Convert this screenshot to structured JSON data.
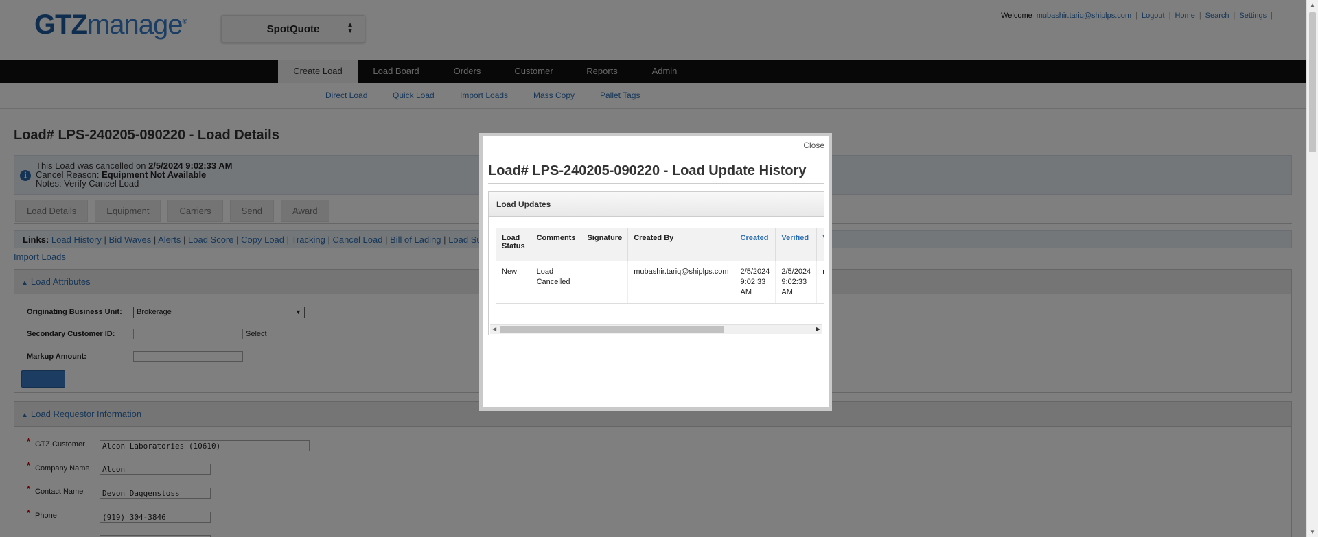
{
  "header": {
    "logo_main": "GTZ",
    "logo_sub": "manage",
    "logo_mark": "®",
    "app_select_value": "SpotQuote",
    "welcome_label": "Welcome",
    "user_email": "mubashir.tariq@shiplps.com",
    "links": [
      "Logout",
      "Home",
      "Search",
      "Settings"
    ]
  },
  "nav": {
    "tabs": [
      "Create Load",
      "Load Board",
      "Orders",
      "Customer",
      "Reports",
      "Admin"
    ],
    "active": "Create Load",
    "subnav": [
      "Direct Load",
      "Quick Load",
      "Import Loads",
      "Mass Copy",
      "Pallet Tags"
    ]
  },
  "page": {
    "title": "Load# LPS-240205-090220 - Load Details",
    "notice": {
      "line1_prefix": "This Load was cancelled on",
      "line1_value": "2/5/2024 9:02:33 AM",
      "line2_prefix": "Cancel Reason:",
      "line2_value": "Equipment Not Available",
      "line3": "Notes: Verify Cancel Load"
    },
    "subtabs": [
      "Load Details",
      "Equipment",
      "Carriers",
      "Send",
      "Award"
    ],
    "links_label": "Links:",
    "links": [
      "Load History",
      "Bid Waves",
      "Alerts",
      "Load Score",
      "Copy Load",
      "Tracking",
      "Cancel Load",
      "Bill of Lading",
      "Load Su"
    ],
    "import_loads": "Import Loads"
  },
  "attributes": {
    "heading": "Load Attributes",
    "business_unit_label": "Originating Business Unit:",
    "business_unit_value": "Brokerage",
    "secondary_id_label": "Secondary Customer ID:",
    "secondary_id_value": "",
    "select_label": "Select",
    "markup_label": "Markup Amount:",
    "markup_value": ""
  },
  "requestor": {
    "heading": "Load Requestor Information",
    "customer_label": "GTZ Customer",
    "customer_value": "Alcon Laboratories (10610)",
    "company_label": "Company Name",
    "company_value": "Alcon",
    "contact_label": "Contact Name",
    "contact_value": "Devon Daggenstoss",
    "phone_label": "Phone",
    "phone_value": "(919) 304-3846"
  },
  "modal": {
    "close_label": "Close",
    "title": "Load# LPS-240205-090220 - Load Update History",
    "panel_title": "Load Updates",
    "columns": [
      "Load Status",
      "Comments",
      "Signature",
      "Created By",
      "Created",
      "Verified",
      "V"
    ],
    "rows": [
      {
        "status": "New",
        "comments": "Load Cancelled",
        "signature": "",
        "created_by": "mubashir.tariq@shiplps.com",
        "created": "2/5/2024 9:02:33 AM",
        "verified": "2/5/2024 9:02:33 AM",
        "extra": "n"
      }
    ]
  },
  "colors": {
    "accent": "#2f6fb3",
    "nav_bg": "#111111",
    "overlay": "rgba(0,0,0,0.5)"
  }
}
